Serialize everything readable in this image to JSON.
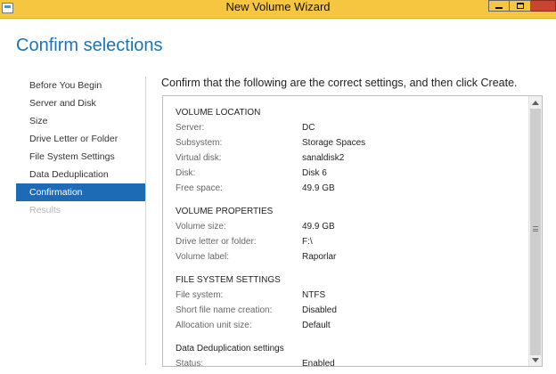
{
  "window": {
    "title": "New Volume Wizard"
  },
  "heading": "Confirm selections",
  "nav": {
    "items": [
      {
        "label": "Before You Begin",
        "state": "normal"
      },
      {
        "label": "Server and Disk",
        "state": "normal"
      },
      {
        "label": "Size",
        "state": "normal"
      },
      {
        "label": "Drive Letter or Folder",
        "state": "normal"
      },
      {
        "label": "File System Settings",
        "state": "normal"
      },
      {
        "label": "Data Deduplication",
        "state": "normal"
      },
      {
        "label": "Confirmation",
        "state": "active"
      },
      {
        "label": "Results",
        "state": "disabled"
      }
    ]
  },
  "instruction": "Confirm that the following are the correct settings, and then click Create.",
  "sections": [
    {
      "title": "VOLUME LOCATION",
      "rows": [
        {
          "key": "Server:",
          "value": "DC"
        },
        {
          "key": "Subsystem:",
          "value": "Storage Spaces"
        },
        {
          "key": "Virtual disk:",
          "value": "sanaldisk2"
        },
        {
          "key": "Disk:",
          "value": "Disk 6"
        },
        {
          "key": "Free space:",
          "value": "49.9 GB"
        }
      ]
    },
    {
      "title": "VOLUME PROPERTIES",
      "rows": [
        {
          "key": "Volume size:",
          "value": "49.9 GB"
        },
        {
          "key": "Drive letter or folder:",
          "value": "F:\\"
        },
        {
          "key": "Volume label:",
          "value": "Raporlar"
        }
      ]
    },
    {
      "title": "FILE SYSTEM SETTINGS",
      "rows": [
        {
          "key": "File system:",
          "value": "NTFS"
        },
        {
          "key": "Short file name creation:",
          "value": "Disabled"
        },
        {
          "key": "Allocation unit size:",
          "value": "Default"
        }
      ]
    },
    {
      "title": "Data Deduplication settings",
      "rows": [
        {
          "key": "Status:",
          "value": "Enabled"
        }
      ]
    }
  ],
  "colors": {
    "titlebar": "#f7c640",
    "close_button": "#c9452f",
    "accent": "#1e6bb5",
    "heading": "#1b73b9"
  }
}
